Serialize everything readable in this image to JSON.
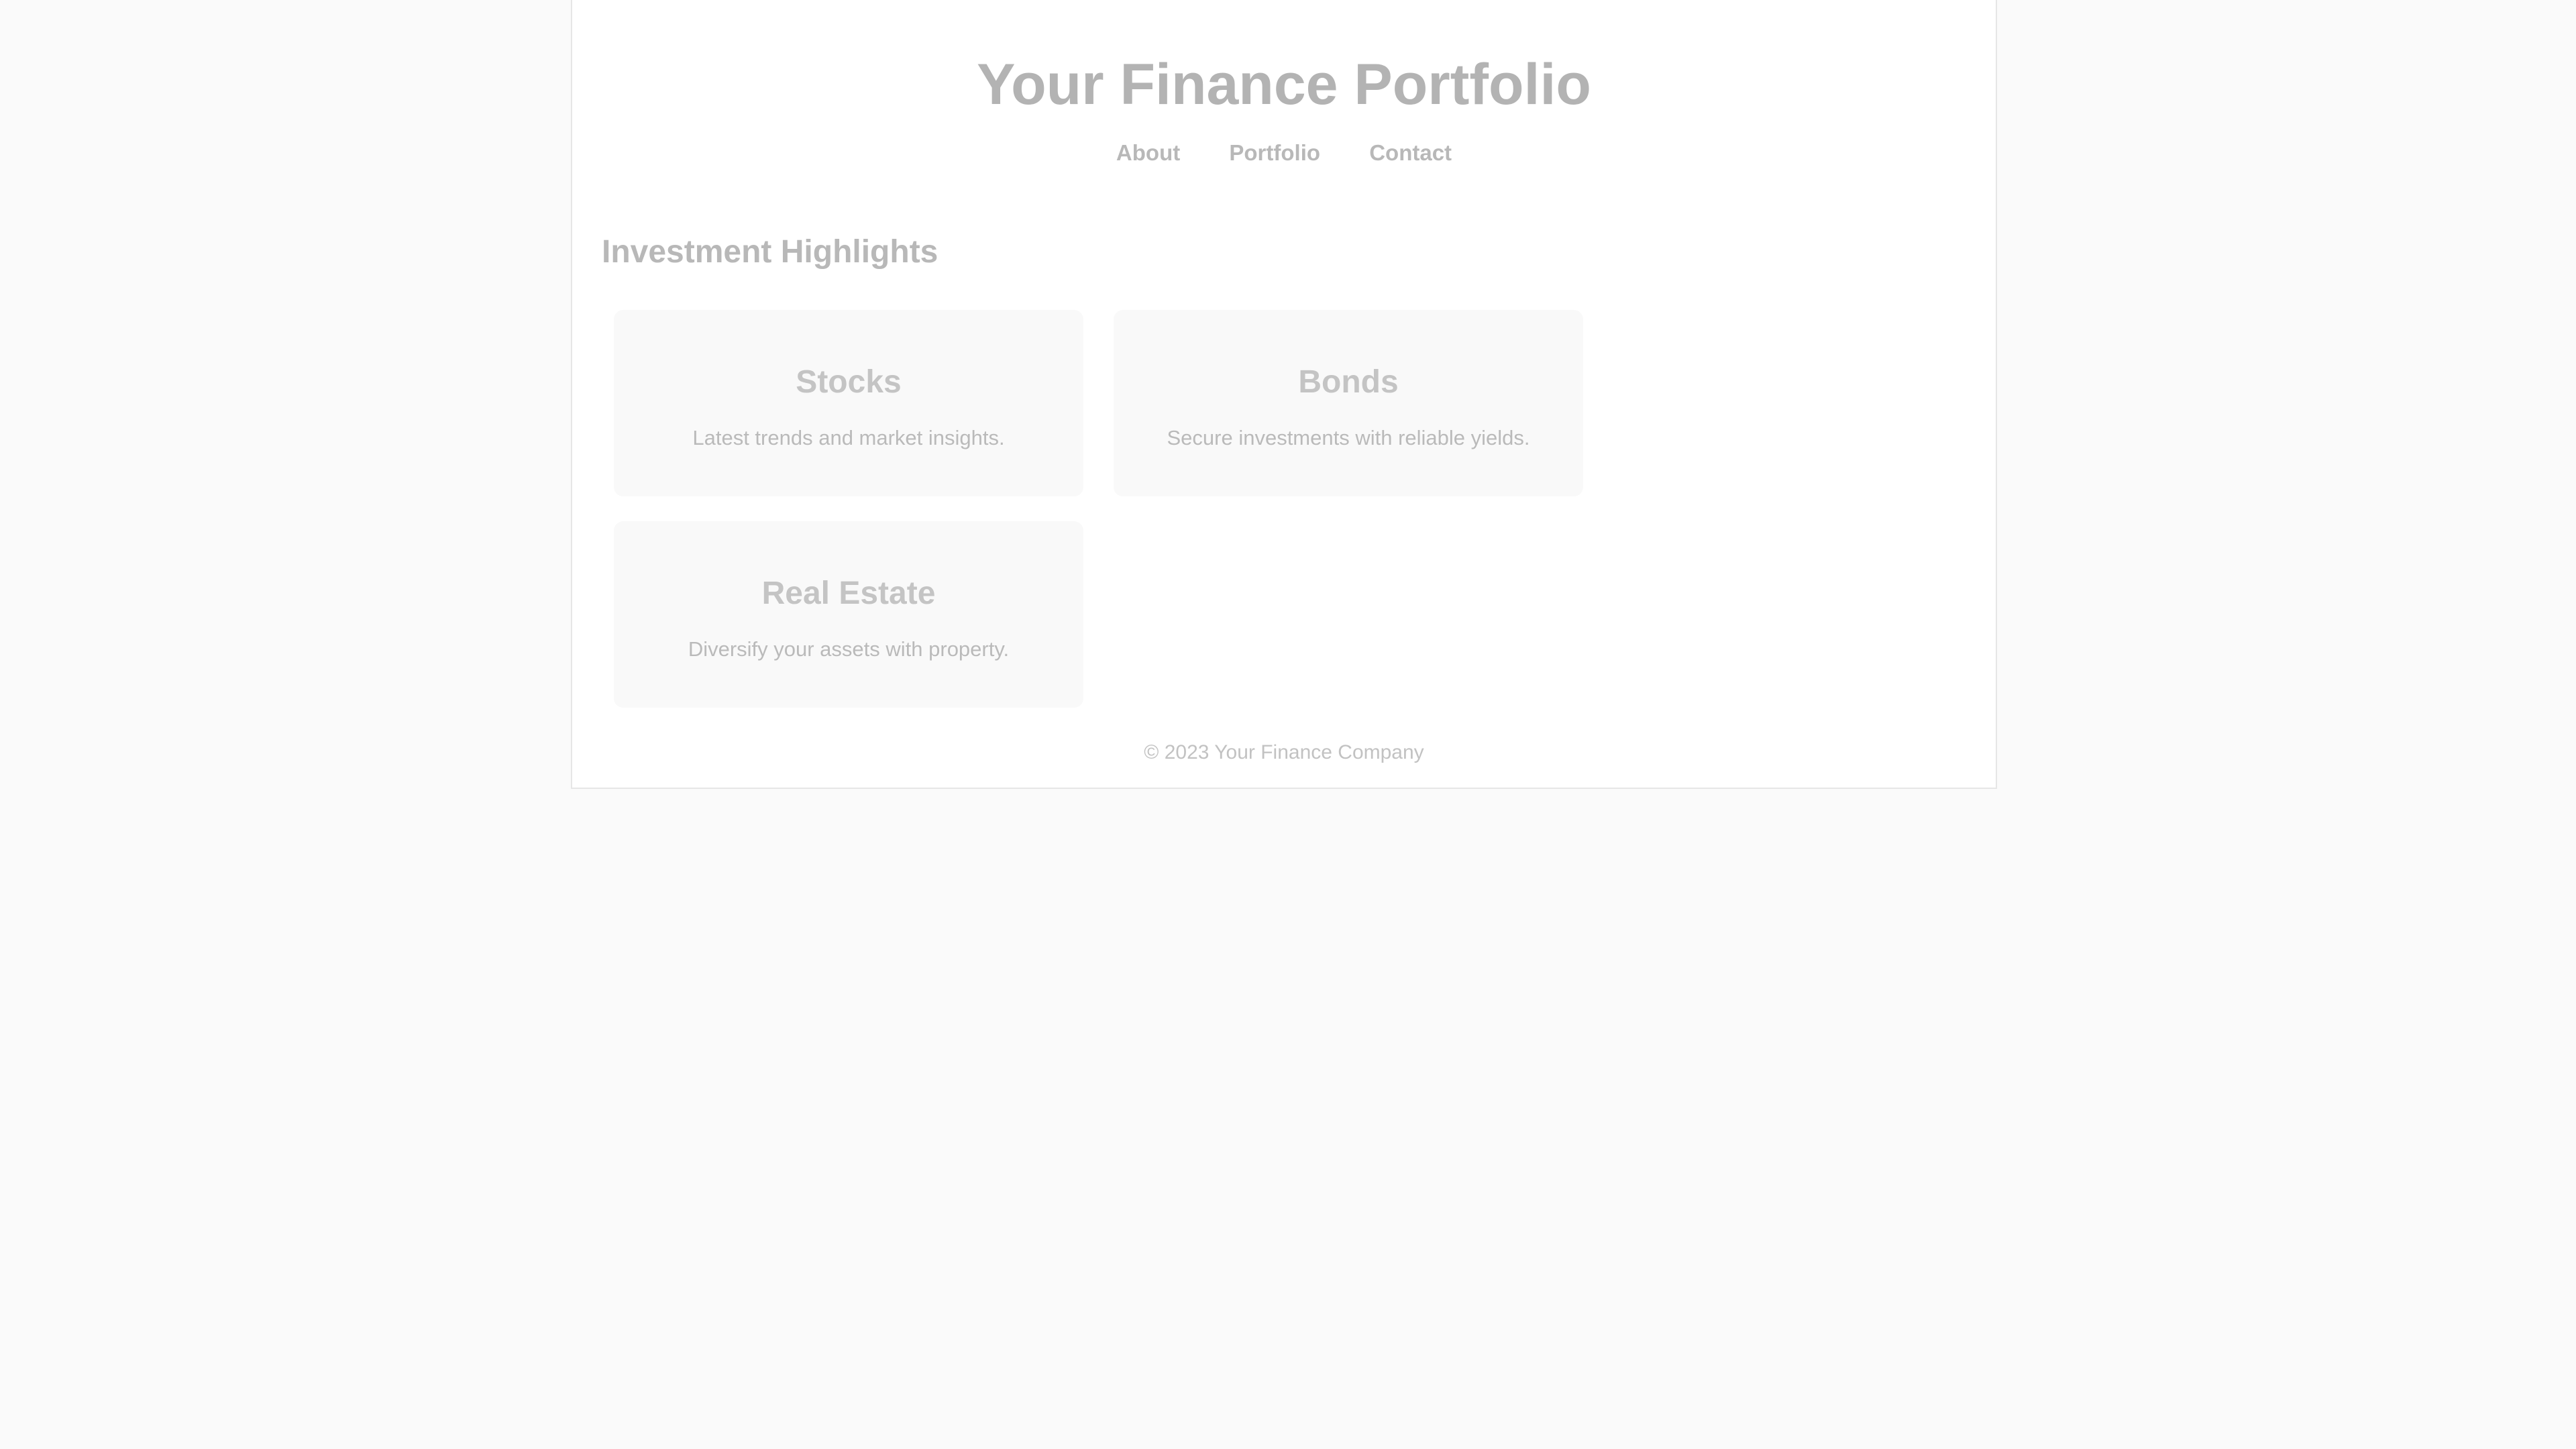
{
  "header": {
    "title": "Your Finance Portfolio",
    "nav": [
      "About",
      "Portfolio",
      "Contact"
    ]
  },
  "main": {
    "section_title": "Investment Highlights",
    "cards": [
      {
        "title": "Stocks",
        "description": "Latest trends and market insights."
      },
      {
        "title": "Bonds",
        "description": "Secure investments with reliable yields."
      },
      {
        "title": "Real Estate",
        "description": "Diversify your assets with property."
      }
    ]
  },
  "footer": {
    "text": "© 2023 Your Finance Company"
  }
}
